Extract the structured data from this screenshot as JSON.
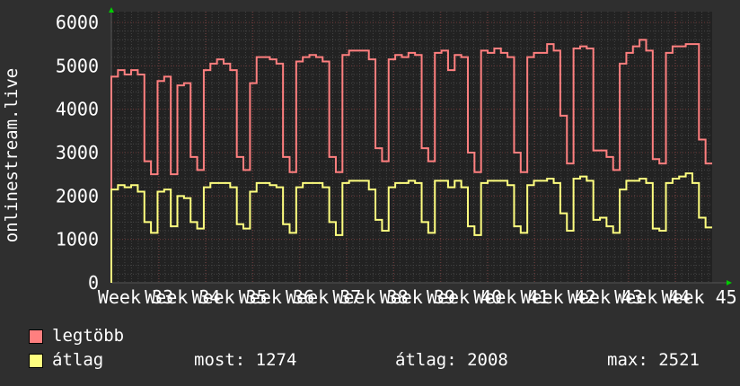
{
  "chart_data": {
    "type": "line",
    "ylabel": "onlinestream.live",
    "ylim": [
      0,
      6000
    ],
    "yticks": [
      "0",
      "1000",
      "2000",
      "3000",
      "4000",
      "5000",
      "6000"
    ],
    "xtick_labels": [
      "Week 33",
      "Week 34",
      "Week 35",
      "Week 36",
      "Week 37",
      "Week 38",
      "Week 39",
      "Week 40",
      "Week 41",
      "Week 42",
      "Week 43",
      "Week 44",
      "Week 45"
    ],
    "grid": true,
    "legend_placement": "bottom-left",
    "series": [
      {
        "name": "legtöbb",
        "color": "#ff7f7f",
        "values": [
          4750,
          4900,
          4800,
          4900,
          4800,
          2800,
          2500,
          4650,
          4750,
          2500,
          4550,
          4600,
          2900,
          2600,
          4900,
          5050,
          5150,
          5050,
          4900,
          2900,
          2600,
          4600,
          5200,
          5200,
          5150,
          5050,
          2900,
          2550,
          5100,
          5200,
          5250,
          5200,
          5100,
          2900,
          2550,
          5250,
          5350,
          5350,
          5350,
          5150,
          3100,
          2800,
          5150,
          5250,
          5200,
          5300,
          5250,
          3100,
          2800,
          5300,
          5350,
          4900,
          5250,
          5200,
          3000,
          2550,
          5350,
          5300,
          5400,
          5300,
          5200,
          3000,
          2550,
          5200,
          5300,
          5300,
          5500,
          5350,
          3850,
          2750,
          5400,
          5450,
          5400,
          3050,
          3050,
          2900,
          2600,
          5050,
          5300,
          5450,
          5600,
          5350,
          2850,
          2750,
          5300,
          5450,
          5450,
          5500,
          5500,
          3300,
          2750
        ]
      },
      {
        "name": "átlag",
        "color": "#ffff7f",
        "values": [
          2150,
          2250,
          2200,
          2250,
          2100,
          1400,
          1150,
          2100,
          2150,
          1300,
          2000,
          1950,
          1400,
          1250,
          2200,
          2300,
          2300,
          2300,
          2200,
          1350,
          1250,
          2100,
          2300,
          2300,
          2250,
          2200,
          1350,
          1150,
          2200,
          2300,
          2300,
          2300,
          2200,
          1400,
          1100,
          2300,
          2350,
          2350,
          2350,
          2150,
          1450,
          1200,
          2200,
          2300,
          2300,
          2350,
          2300,
          1400,
          1150,
          2350,
          2350,
          2200,
          2350,
          2200,
          1300,
          1100,
          2300,
          2350,
          2350,
          2350,
          2250,
          1300,
          1150,
          2250,
          2350,
          2350,
          2400,
          2300,
          1600,
          1200,
          2400,
          2450,
          2350,
          1450,
          1500,
          1300,
          1150,
          2150,
          2350,
          2350,
          2400,
          2300,
          1250,
          1200,
          2300,
          2400,
          2450,
          2521,
          2300,
          1500,
          1274
        ]
      }
    ]
  },
  "legend": {
    "max_label": "legtöbb",
    "avg_label": "átlag",
    "now": "most: 1274",
    "average": "átlag: 2008",
    "maximum": "max: 2521"
  }
}
